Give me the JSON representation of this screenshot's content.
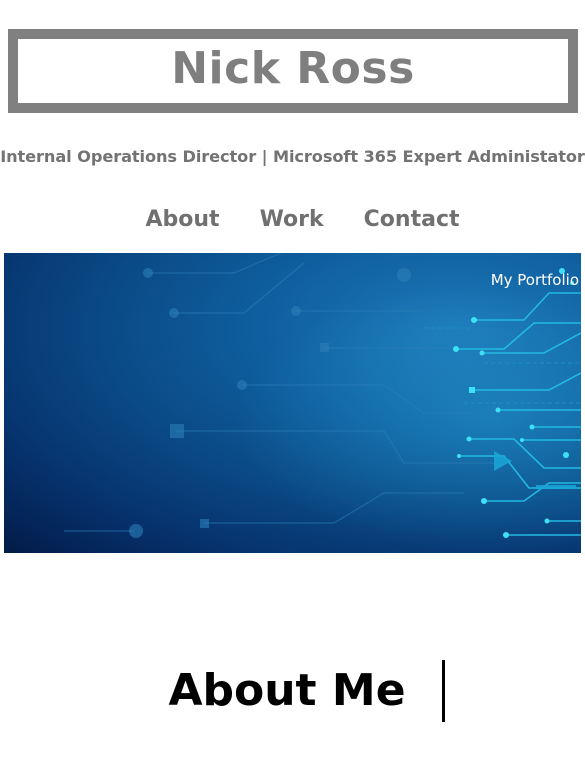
{
  "header": {
    "name": "Nick Ross",
    "subtitle": "Internal Operations Director | Microsoft 365 Expert Administator"
  },
  "nav": {
    "items": [
      {
        "label": "About"
      },
      {
        "label": "Work"
      },
      {
        "label": "Contact"
      }
    ]
  },
  "hero": {
    "label": "My Portfolio"
  },
  "about": {
    "heading": "About Me"
  },
  "colors": {
    "title_border": "#808080",
    "title_text": "#7f7f7f",
    "nav_text": "#707070",
    "hero_dark": "#021c48",
    "hero_light": "#1d78b8",
    "circuit_glow": "#2fd3f0"
  }
}
